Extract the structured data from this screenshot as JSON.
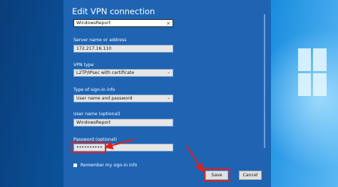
{
  "dialog": {
    "title": "Edit VPN connection",
    "connection_name": "WindowsReport",
    "server_label": "Server name or address",
    "server_value": "172.217.16.110",
    "vpn_type_label": "VPN type",
    "vpn_type_value": "L2TP/IPsec with certificate",
    "signin_label": "Type of sign-in info",
    "signin_value": "User name and password",
    "username_label": "User name (optional)",
    "username_value": "WindowsReport",
    "password_label": "Password (optional)",
    "password_value": "••••••••••",
    "checkbox_text": "Remember my sign-in info",
    "save_label": "Save",
    "cancel_label": "Cancel"
  },
  "icons": {
    "clear": "×",
    "dropdown": "⌄"
  },
  "colors": {
    "dialog_bg": "#1e64b3",
    "highlight": "#e02020"
  }
}
